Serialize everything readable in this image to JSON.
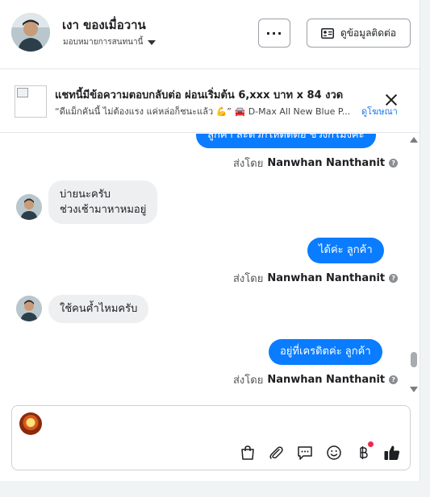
{
  "header": {
    "name": "เงา ของเมื่อวาน",
    "subtitle": "มอบหมายการสนทนานี้",
    "more_label": "···",
    "contact_label": "ดูข้อมูลติดต่อ"
  },
  "ad": {
    "title": "แชทนี้มีข้อความตอบกลับต่อ ผ่อนเริ่มต้น 6,xxx บาท x 84 งวด",
    "description": "“ดีแม็กคันนี้ ไม่ต้องแรง แค่หล่อก็ชนะแล้ว 💪” 🚘 D-Max All New Blue P...",
    "link": "ดูโฆษณา"
  },
  "messages": [
    {
      "type": "out",
      "text": "ลูกค้า สะดวกให้ติดต่อ ช่วงกี่โมงคะ"
    },
    {
      "type": "sent_by",
      "prefix": "ส่งโดย",
      "agent": "Nanwhan Nanthanit"
    },
    {
      "type": "in",
      "lines": [
        "บ่ายนะครับ",
        "ช่วงเช้ามาหาหมอยู่"
      ]
    },
    {
      "type": "out",
      "text": "ได้ค่ะ  ลูกค้า"
    },
    {
      "type": "sent_by",
      "prefix": "ส่งโดย",
      "agent": "Nanwhan Nanthanit"
    },
    {
      "type": "in",
      "lines": [
        "ใช้คนค้ำไหมครับ"
      ]
    },
    {
      "type": "out",
      "text": "อยู่ที่เครดิตค่ะ  ลูกค้า"
    },
    {
      "type": "sent_by",
      "prefix": "ส่งโดย",
      "agent": "Nanwhan Nanthanit"
    }
  ],
  "composer": {
    "placeholder": "",
    "tools": [
      "shopping-bag-icon",
      "paperclip-icon",
      "saved-reply-icon",
      "emoji-icon",
      "baht-payment-icon",
      "thumbs-up-icon"
    ]
  },
  "colors": {
    "outgoing_bubble": "#0a7cff",
    "incoming_bubble": "#eeeff1",
    "link": "#1877f2",
    "notification": "#f02849"
  }
}
